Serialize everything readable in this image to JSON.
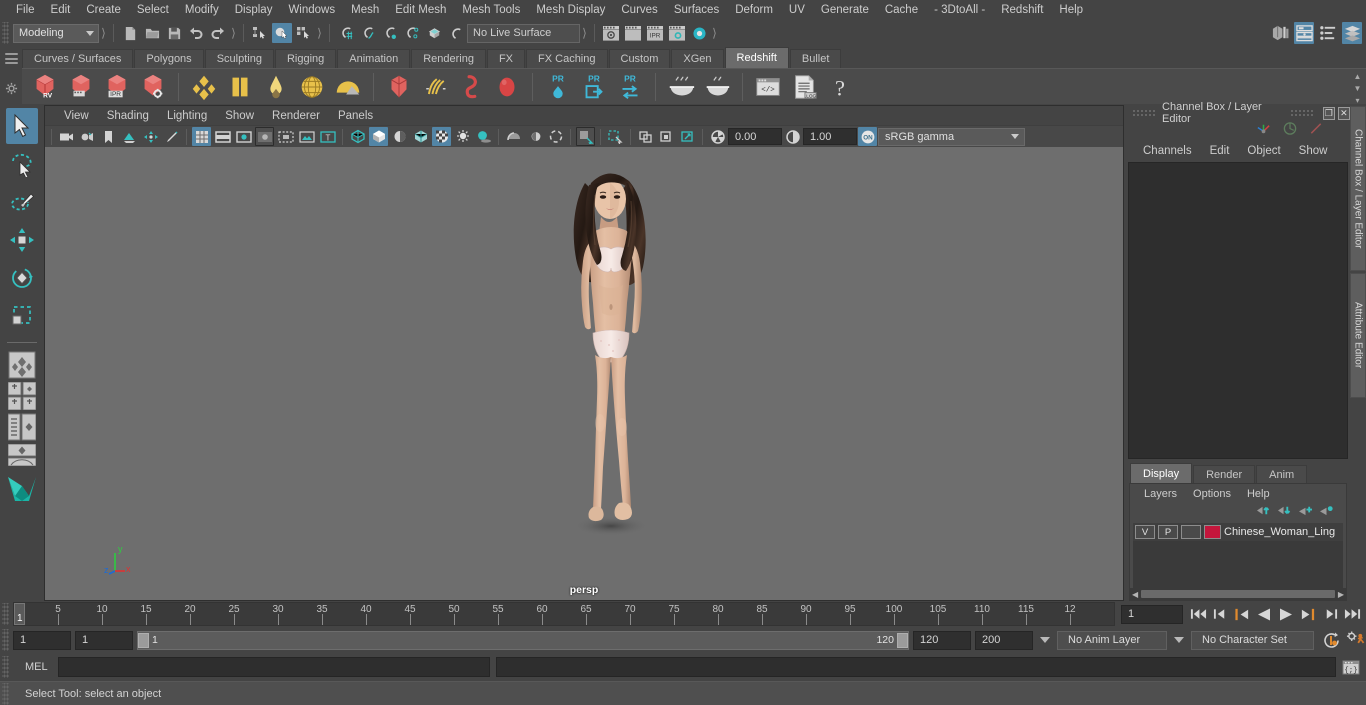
{
  "app": {
    "title": "Autodesk Maya",
    "menus": [
      "File",
      "Edit",
      "Create",
      "Select",
      "Modify",
      "Display",
      "Windows",
      "Mesh",
      "Edit Mesh",
      "Mesh Tools",
      "Mesh Display",
      "Curves",
      "Surfaces",
      "Deform",
      "UV",
      "Generate",
      "Cache",
      "- 3DtoAll -",
      "Redshift",
      "Help"
    ]
  },
  "status_line": {
    "mode_menu": "Modeling",
    "live_surface": "No Live Surface",
    "file_icons": [
      "new-scene-icon",
      "open-scene-icon",
      "save-scene-icon",
      "undo-icon",
      "redo-icon"
    ],
    "selection_mode_icons": [
      "select-by-hierarchy-icon",
      "select-by-object-type-icon",
      "select-by-component-type-icon"
    ],
    "snap_icons": [
      "snap-to-grid-icon",
      "snap-to-curve-icon",
      "snap-to-point-icon",
      "snap-to-projected-center-icon",
      "snap-to-view-plane-icon",
      "make-live-icon"
    ],
    "render_icons": [
      "render-current-frame-icon",
      "render-sequence-icon",
      "ipr-render-icon",
      "render-settings-icon",
      "hypershade-icon"
    ],
    "sidebar_toggles": [
      "modeling-toolkit-icon",
      "attribute-editor-icon",
      "tool-settings-icon",
      "channel-box-icon"
    ]
  },
  "shelf": {
    "tabs": [
      "Curves / Surfaces",
      "Polygons",
      "Sculpting",
      "Rigging",
      "Animation",
      "Rendering",
      "FX",
      "FX Caching",
      "Custom",
      "XGen",
      "Redshift",
      "Bullet"
    ],
    "active_tab": "Redshift",
    "icons": [
      "redshift-rv-icon",
      "redshift-render-icon",
      "redshift-ipr-icon",
      "redshift-settings-icon",
      "redshift-material-icon",
      "redshift-sss-icon",
      "redshift-incandescent-icon",
      "redshift-dome-light-icon",
      "redshift-environment-icon",
      "redshift-proxy-icon",
      "redshift-hair-icon",
      "redshift-volume-icon",
      "redshift-sphere-icon",
      "redshift-pr-light-icon",
      "redshift-pr-export-icon",
      "redshift-pr-switch-icon",
      "redshift-bake-icon",
      "redshift-bake-set-icon",
      "redshift-shader-code-icon",
      "redshift-log-icon",
      "redshift-help-icon"
    ]
  },
  "toolbox": {
    "tools": [
      {
        "name": "select-tool",
        "active": true
      },
      {
        "name": "lasso-select-tool",
        "active": false
      },
      {
        "name": "paint-select-tool",
        "active": false
      },
      {
        "name": "move-tool",
        "active": false
      },
      {
        "name": "rotate-tool",
        "active": false
      },
      {
        "name": "scale-tool",
        "active": false
      }
    ],
    "layouts": [
      "single-perspective-layout",
      "four-view-layout",
      "outliner-persp-layout",
      "persp-graph-layout"
    ],
    "logo": "maya-logo-icon"
  },
  "viewport": {
    "menus": [
      "View",
      "Shading",
      "Lighting",
      "Show",
      "Renderer",
      "Panels"
    ],
    "camera_label": "persp",
    "exposure": "0.00",
    "gamma": "1.00",
    "color_management": "sRGB gamma",
    "toolbar_icons": [
      "select-camera-icon",
      "camera-attributes-icon",
      "bookmark-icon",
      "image-plane-icon",
      "two-d-pan-zoom-icon",
      "grease-pencil-icon",
      "grid-toggle-icon",
      "film-gate-icon",
      "resolution-gate-icon",
      "gate-mask-icon",
      "field-chart-icon",
      "safe-action-icon",
      "safe-title-icon",
      "wireframe-icon",
      "smooth-shade-all-icon",
      "shade-flat-icon",
      "wireframe-on-shaded-icon",
      "texture-toggle-icon",
      "use-default-lighting-icon",
      "shadows-icon",
      "screen-space-ao-icon",
      "motion-blur-icon",
      "multisample-icon",
      "isolate-select-icon",
      "xray-icon",
      "xray-joints-icon",
      "xray-active-components-icon",
      "exposure-icon",
      "gamma-icon",
      "color-management-icon"
    ]
  },
  "right_panel": {
    "title": "Channel Box / Layer Editor",
    "window_buttons": [
      "restore-icon",
      "close-icon"
    ],
    "channel_menus": [
      "Channels",
      "Edit",
      "Object",
      "Show"
    ],
    "top_icons": [
      "channel-box-toggle-icon",
      "attribute-editor-toggle-icon",
      "tool-settings-toggle-icon"
    ],
    "layer_tabs": [
      "Display",
      "Render",
      "Anim"
    ],
    "active_layer_tab": "Display",
    "layer_menus": [
      "Layers",
      "Options",
      "Help"
    ],
    "layer_buttons": [
      "move-layer-up-icon",
      "move-layer-down-icon",
      "create-new-layer-icon",
      "create-layer-from-selected-icon"
    ],
    "layers": [
      {
        "visibility": "V",
        "playback": "P",
        "shading": "",
        "color": "#c4163c",
        "name": "Chinese_Woman_Ling"
      }
    ],
    "vertical_tabs": [
      "Channel Box / Layer Editor",
      "Attribute Editor"
    ]
  },
  "time_slider": {
    "tick_labels": [
      "5",
      "10",
      "15",
      "20",
      "25",
      "30",
      "35",
      "40",
      "45",
      "50",
      "55",
      "60",
      "65",
      "70",
      "75",
      "80",
      "85",
      "90",
      "95",
      "100",
      "105",
      "110",
      "115",
      "12"
    ],
    "current_frame": "1",
    "current_frame_field": "1",
    "playback_buttons": [
      "go-to-start-icon",
      "step-back-keyframe-icon",
      "step-back-frame-icon",
      "play-backwards-icon",
      "play-forwards-icon",
      "step-forward-frame-icon",
      "step-forward-keyframe-icon",
      "go-to-end-icon"
    ]
  },
  "range_slider": {
    "anim_start": "1",
    "range_start": "1",
    "range_bar_start": "1",
    "range_bar_end": "120",
    "range_end": "120",
    "anim_end": "200",
    "anim_layer": "No Anim Layer",
    "character_set": "No Character Set",
    "right_icons": [
      "auto-key-icon",
      "animation-preferences-icon"
    ]
  },
  "command_line": {
    "label": "MEL",
    "input_value": "",
    "output_value": "",
    "script_editor_icon": "script-editor-icon"
  },
  "status_bar": {
    "help_text": "Select Tool: select an object"
  },
  "colors": {
    "accent_blue": "#5285a6",
    "panel_bg": "#444444",
    "viewport_bg": "#6e6e6e",
    "field_bg": "#2f2f2f",
    "layer_color": "#c4163c",
    "redshift_red": "#e05050",
    "orange": "#d07a30"
  }
}
